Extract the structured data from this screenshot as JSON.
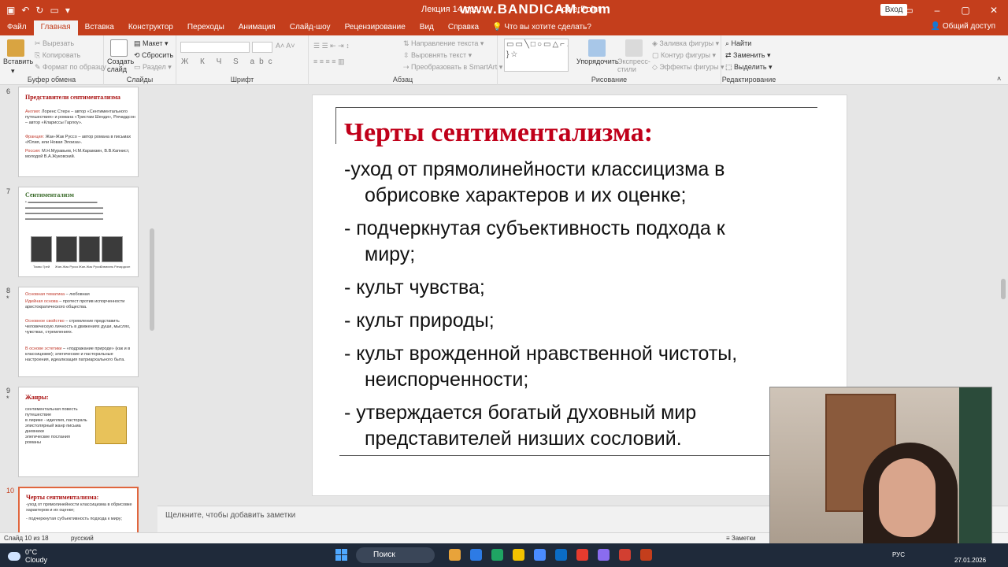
{
  "window": {
    "title": "Лекция 14.ppt...",
    "watermark": "www.BANDICAM.com",
    "app_suffix": "PowerPoint",
    "login": "Вход"
  },
  "tabs": [
    "Файл",
    "Главная",
    "Вставка",
    "Конструктор",
    "Переходы",
    "Анимация",
    "Слайд-шоу",
    "Рецензирование",
    "Вид",
    "Справка"
  ],
  "active_tab": "Главная",
  "tell_me": "Что вы хотите сделать?",
  "share": "Общий доступ",
  "ribbon": {
    "clipboard": {
      "label": "Буфер обмена",
      "paste": "Вставить",
      "cut": "Вырезать",
      "copy": "Копировать",
      "format_painter": "Формат по образцу"
    },
    "slides": {
      "label": "Слайды",
      "new_slide": "Создать слайд",
      "layout": "Макет",
      "reset": "Сбросить",
      "section": "Раздел"
    },
    "font": {
      "label": "Шрифт",
      "format_buttons": "Ж К Ч S abc"
    },
    "paragraph": {
      "label": "Абзац",
      "text_direction": "Направление текста",
      "align_text": "Выровнять текст",
      "smartart": "Преобразовать в SmartArt"
    },
    "drawing": {
      "label": "Рисование",
      "arrange": "Упорядочить",
      "quick_styles": "Экспресс-стили",
      "shape_fill": "Заливка фигуры",
      "shape_outline": "Контур фигуры",
      "shape_effects": "Эффекты фигуры",
      "shapes_glyphs": "▭▭╲□○▭△⌐↗⇨⇩☆⌒{ }☆"
    },
    "editing": {
      "label": "Редактирование",
      "find": "Найти",
      "replace": "Заменить",
      "select": "Выделить"
    }
  },
  "thumbnails": [
    {
      "num": "6",
      "title": "Представители сентиментализма",
      "lines": [
        {
          "prefix": "Англия:",
          "text": " Лоренс Стерн – автор «Сентиментального путешествия» и романа «Тристам Шенди», Ричардсон – автор «Клариссы Гарлоу»."
        },
        {
          "prefix": "Франция:",
          "text": " Жан-Жак Руссо – автор романа в письмах «Юлия, или Новая Элоиза»."
        },
        {
          "prefix": "Россия:",
          "text": " М.Н.Муравьев, Н.М.Карамзин, В.В.Капнист, молодой В.А.Жуковский."
        }
      ]
    },
    {
      "num": "7",
      "title": "Сентиментализм",
      "captions": [
        "Томас Грей",
        "Жан-Жак Руссо",
        "Жан-Жак Руссо",
        "Сэмюэль Ричардсон"
      ]
    },
    {
      "num": "8",
      "lines": [
        {
          "prefix": "Основная тематика",
          "text": " – любовная"
        },
        {
          "prefix": "Идейная основа",
          "text": " – протест против испорченности аристократического общества."
        },
        {
          "prefix": "Основное свойство",
          "text": " – стремление представить человеческую личность в движениях души, мыслях, чувствах, стремлениях."
        },
        {
          "prefix": "В основе эстетики",
          "text": " – «подражание природе» (как и в классицизме); элегические и пасторальные настроения, идеализация патриархального быта."
        }
      ]
    },
    {
      "num": "9",
      "title": "Жанры:",
      "lines": [
        "сентиментальная повесть",
        "путешествие",
        "в лирике - идиллия, пастораль",
        "эпистолярный жанр письма",
        "дневники",
        "элегические послания",
        "романы"
      ]
    },
    {
      "num": "10",
      "title": "Черты сентиментализма:",
      "lines": [
        "-уход от прямолинейности классицизма в обрисовке характеров и их оценке;",
        "- подчеркнутая субъективность подхода к миру;"
      ]
    }
  ],
  "slide": {
    "title": "Черты сентиментализма:",
    "items": [
      {
        "first": "-уход от прямолинейности классицизма в",
        "cont": "обрисовке характеров и их оценке;"
      },
      {
        "first": "- подчеркнутая субъективность подхода к",
        "cont": "миру;"
      },
      {
        "first": "- культ чувства;",
        "cont": ""
      },
      {
        "first": "- культ природы;",
        "cont": ""
      },
      {
        "first": "- культ врожденной нравственной чистоты,",
        "cont": "неиспорченности;"
      },
      {
        "first": "- утверждается богатый духовный мир",
        "cont": "представителей низших сословий."
      }
    ]
  },
  "notes_placeholder": "Щелкните, чтобы добавить заметки",
  "status": {
    "slide_of": "Слайд 10 из 18",
    "language": "русский",
    "notes": "Заметки"
  },
  "taskbar": {
    "temperature": "0°C",
    "weather": "Cloudy",
    "search": "Поиск",
    "lang": "РУС",
    "date": "27.01.2026",
    "app_colors": [
      "#e8a33a",
      "#2d7be5",
      "#1fa463",
      "#f2c200",
      "#4a8cff",
      "#0b6cc5",
      "#e63b2e",
      "#8a6cf0",
      "#d23f31",
      "#c43e1c"
    ]
  }
}
